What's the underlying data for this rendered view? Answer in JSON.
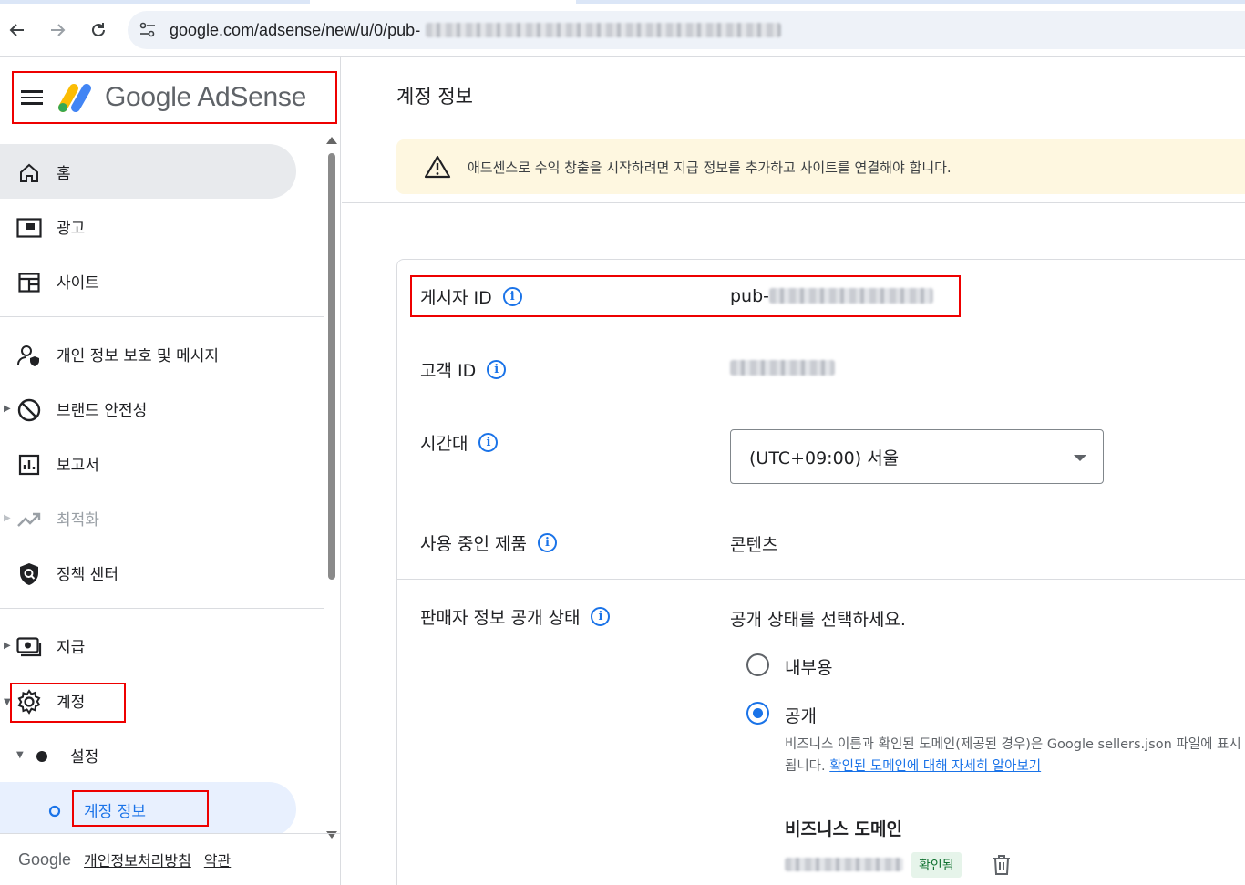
{
  "browser": {
    "url_prefix": "google.com/adsense/new/u/0/pub-"
  },
  "brand": {
    "name": "Google AdSense"
  },
  "sidebar": {
    "items": [
      {
        "label": "홈",
        "icon": "home-icon"
      },
      {
        "label": "광고",
        "icon": "ads-icon"
      },
      {
        "label": "사이트",
        "icon": "sites-icon"
      },
      {
        "label": "개인 정보 보호 및 메시지",
        "icon": "privacy-icon"
      },
      {
        "label": "브랜드 안전성",
        "icon": "block-icon"
      },
      {
        "label": "보고서",
        "icon": "reports-icon"
      },
      {
        "label": "최적화",
        "icon": "trending-icon"
      },
      {
        "label": "정책 센터",
        "icon": "policy-icon"
      },
      {
        "label": "지급",
        "icon": "payments-icon"
      },
      {
        "label": "계정",
        "icon": "gear-icon"
      },
      {
        "label": "설정",
        "icon": "dot-icon"
      },
      {
        "label": "계정 정보",
        "icon": "circle-icon"
      }
    ],
    "footer": {
      "google": "Google",
      "privacy": "개인정보처리방침",
      "terms": "약관"
    }
  },
  "main": {
    "title": "계정 정보",
    "alert": "애드센스로 수익 창출을 시작하려면 지급 정보를 추가하고 사이트를 연결해야 합니다.",
    "rows": {
      "publisher_id": {
        "label": "게시자 ID",
        "value_prefix": "pub-"
      },
      "customer_id": {
        "label": "고객 ID"
      },
      "timezone": {
        "label": "시간대",
        "value": "(UTC+09:00) 서울"
      },
      "products": {
        "label": "사용 중인 제품",
        "value": "콘텐츠"
      },
      "seller_info": {
        "label": "판매자 정보 공개 상태",
        "prompt": "공개 상태를 선택하세요.",
        "options": [
          "내부용",
          "공개"
        ],
        "selected": "공개",
        "help": "비즈니스 이름과 확인된 도메인(제공된 경우)은 Google sellers.json 파일에 표시됩니다.",
        "help_link": "확인된 도메인에 대해 자세히 알아보기"
      },
      "business_domain": {
        "title": "비즈니스 도메인",
        "status": "확인됨"
      }
    }
  },
  "colors": {
    "accent": "#1a73e8",
    "highlight_box": "#e00000",
    "alert_bg": "#fef7e0",
    "verified_bg": "#e6f4ea",
    "verified_text": "#137333"
  }
}
